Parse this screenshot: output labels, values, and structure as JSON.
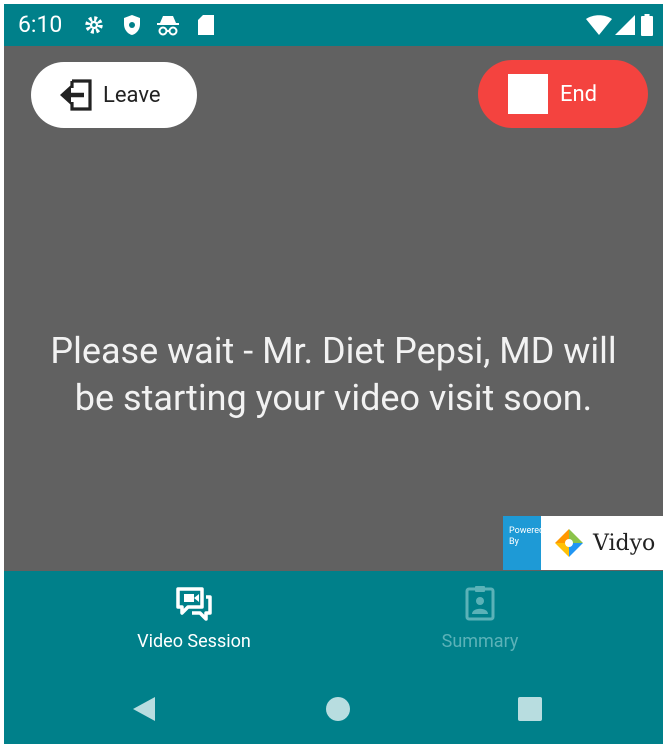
{
  "status_bar": {
    "time": "6:10",
    "icons": [
      "gear-icon",
      "shield-icon",
      "incognito-icon",
      "sd-card-icon",
      "wifi-icon",
      "signal-icon",
      "battery-icon"
    ]
  },
  "video": {
    "leave_label": "Leave",
    "end_label": "End",
    "message_line1": "Please wait - Mr. Diet Pepsi, MD will",
    "message_line2": "be starting your video visit soon.",
    "powered_line1": "Powered",
    "powered_line2": "By",
    "brand_name": "Vidyo"
  },
  "tabs": [
    {
      "label": "Video Session",
      "active": true
    },
    {
      "label": "Summary",
      "active": false
    }
  ],
  "nav": [
    "back-icon",
    "home-icon",
    "recents-icon"
  ],
  "colors": {
    "teal": "#00808a",
    "video_bg": "#616161",
    "end_red": "#f4433f",
    "inactive_tab": "#5bb2b8"
  }
}
